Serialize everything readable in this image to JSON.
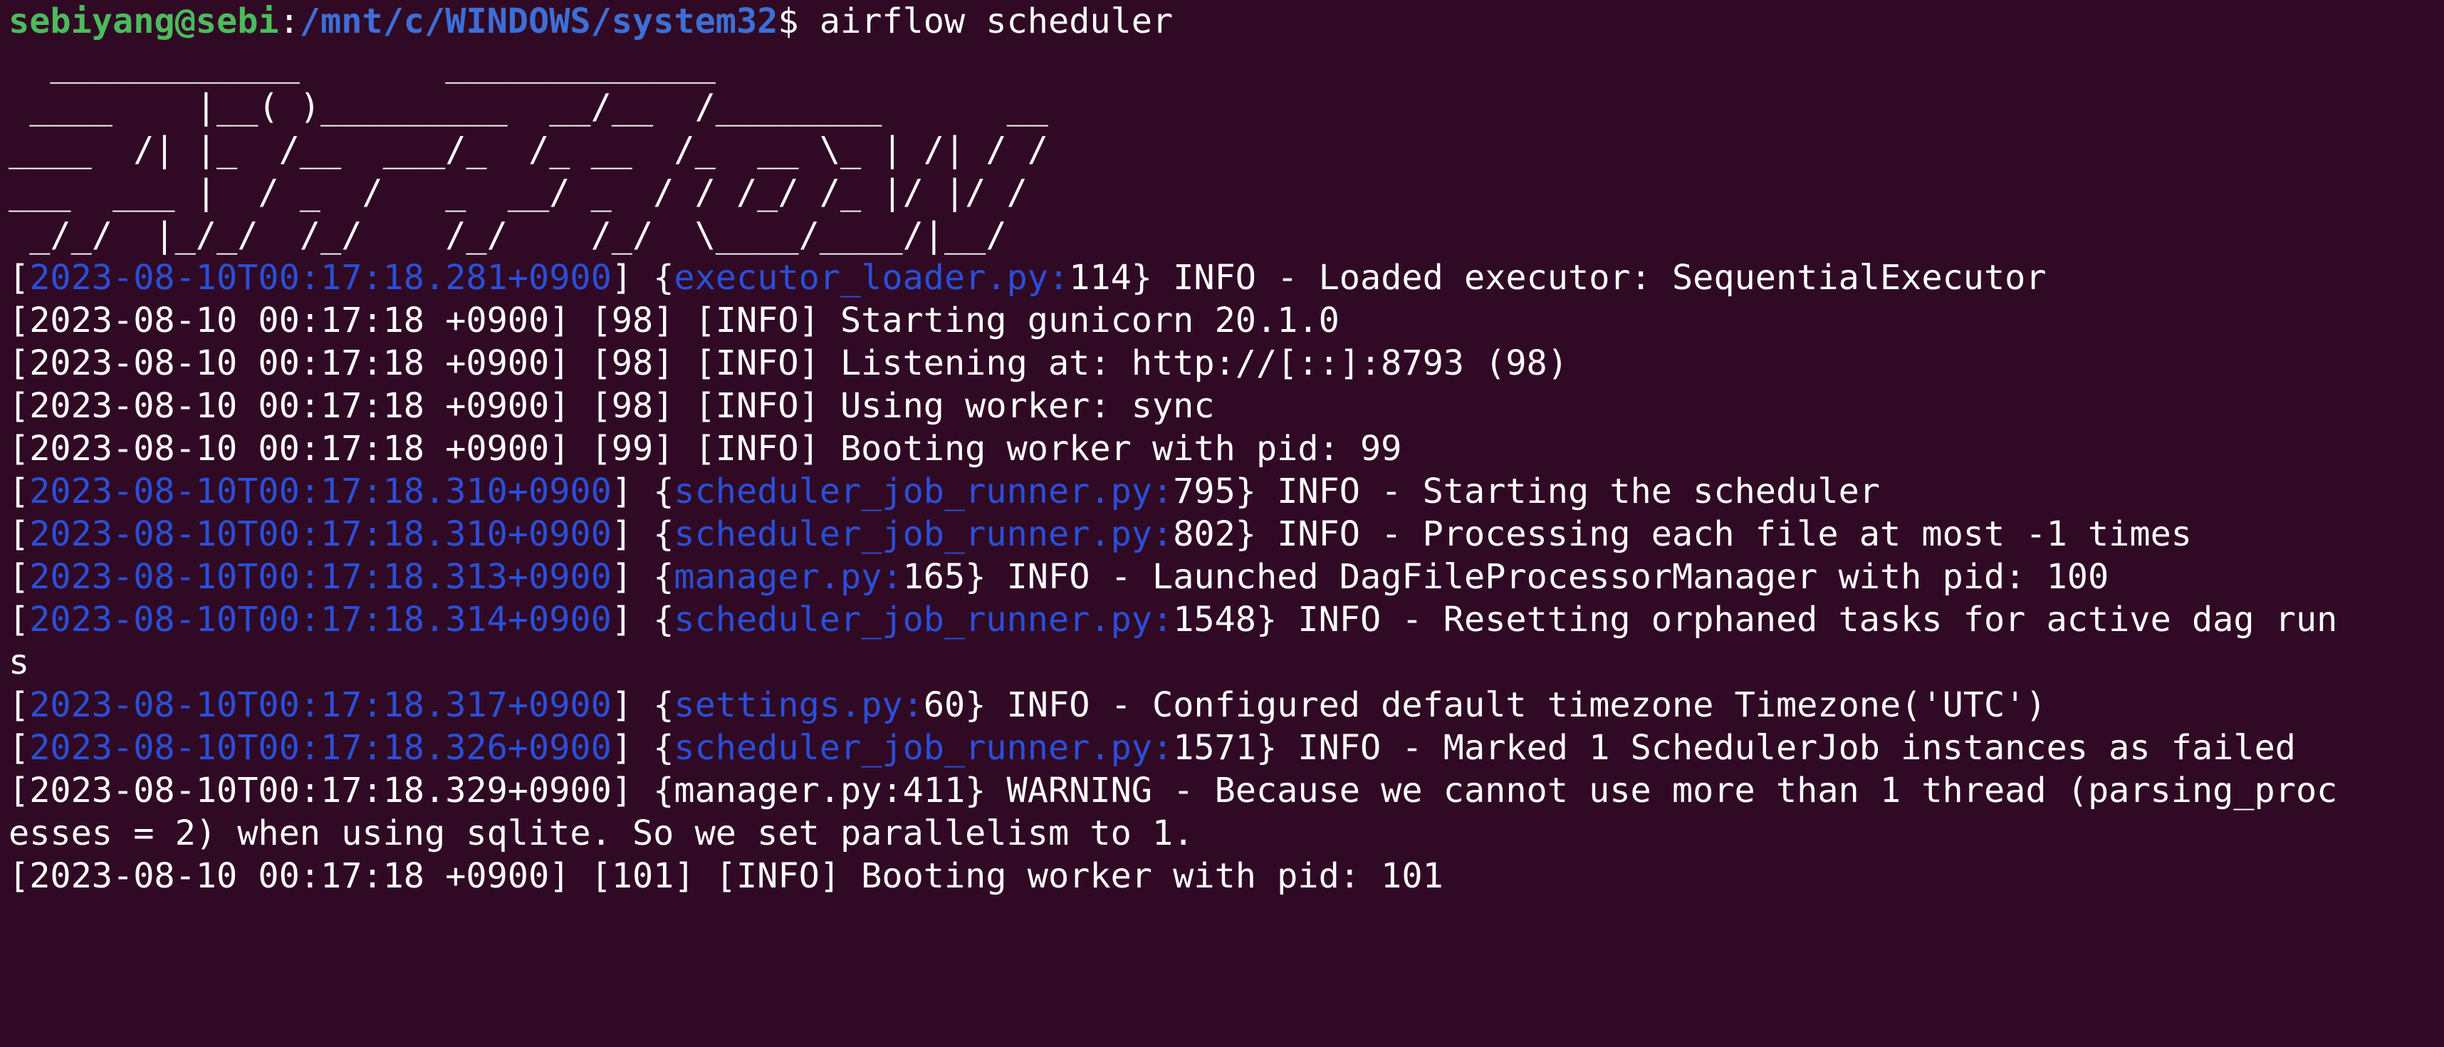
{
  "window": {
    "background": "#300a24",
    "foreground": "#ffffff"
  },
  "prompt": {
    "user_host": "sebiyang@sebi",
    "separator": ":",
    "path": "/mnt/c/WINDOWS/system32",
    "symbol": "$ ",
    "command": "airflow scheduler",
    "user_color": "#4cbb5c",
    "path_color": "#3d6fd6"
  },
  "banner": [
    "  ____________       _____________",
    " ____    |__( )_________  __/__  /________      __",
    "____  /| |_  /__  ___/_  /_ __  /_  __ \\_ | /| / /",
    "___  ___ |  / _  /   _  __/ _  / / /_/ /_ |/ |/ /",
    " _/_/  |_/_/  /_/    /_/    /_/  \\____/____/|__/"
  ],
  "log": [
    {
      "kind": "colored",
      "ts": "2023-08-10T00:17:18.281+0900",
      "src": "executor_loader.py:",
      "rest": "114} INFO - Loaded executor: SequentialExecutor"
    },
    {
      "kind": "plain",
      "text": "[2023-08-10 00:17:18 +0900] [98] [INFO] Starting gunicorn 20.1.0"
    },
    {
      "kind": "plain",
      "text": "[2023-08-10 00:17:18 +0900] [98] [INFO] Listening at: http://[::]:8793 (98)"
    },
    {
      "kind": "plain",
      "text": "[2023-08-10 00:17:18 +0900] [98] [INFO] Using worker: sync"
    },
    {
      "kind": "plain",
      "text": "[2023-08-10 00:17:18 +0900] [99] [INFO] Booting worker with pid: 99"
    },
    {
      "kind": "colored",
      "ts": "2023-08-10T00:17:18.310+0900",
      "src": "scheduler_job_runner.py:",
      "rest": "795} INFO - Starting the scheduler"
    },
    {
      "kind": "colored",
      "ts": "2023-08-10T00:17:18.310+0900",
      "src": "scheduler_job_runner.py:",
      "rest": "802} INFO - Processing each file at most -1 times"
    },
    {
      "kind": "colored",
      "ts": "2023-08-10T00:17:18.313+0900",
      "src": "manager.py:",
      "rest": "165} INFO - Launched DagFileProcessorManager with pid: 100"
    },
    {
      "kind": "colored",
      "ts": "2023-08-10T00:17:18.314+0900",
      "src": "scheduler_job_runner.py:",
      "rest": "1548} INFO - Resetting orphaned tasks for active dag run"
    },
    {
      "kind": "plain",
      "text": "s"
    },
    {
      "kind": "colored",
      "ts": "2023-08-10T00:17:18.317+0900",
      "src": "settings.py:",
      "rest": "60} INFO - Configured default timezone Timezone('UTC')"
    },
    {
      "kind": "colored",
      "ts": "2023-08-10T00:17:18.326+0900",
      "src": "scheduler_job_runner.py:",
      "rest": "1571} INFO - Marked 1 SchedulerJob instances as failed"
    },
    {
      "kind": "plain",
      "text": "[2023-08-10T00:17:18.329+0900] {manager.py:411} WARNING - Because we cannot use more than 1 thread (parsing_proc"
    },
    {
      "kind": "plain",
      "text": "esses = 2) when using sqlite. So we set parallelism to 1."
    },
    {
      "kind": "plain",
      "text": "[2023-08-10 00:17:18 +0900] [101] [INFO] Booting worker with pid: 101"
    }
  ],
  "log_colors": {
    "timestamp": "#2a4fd9",
    "source": "#2a4fd9"
  }
}
